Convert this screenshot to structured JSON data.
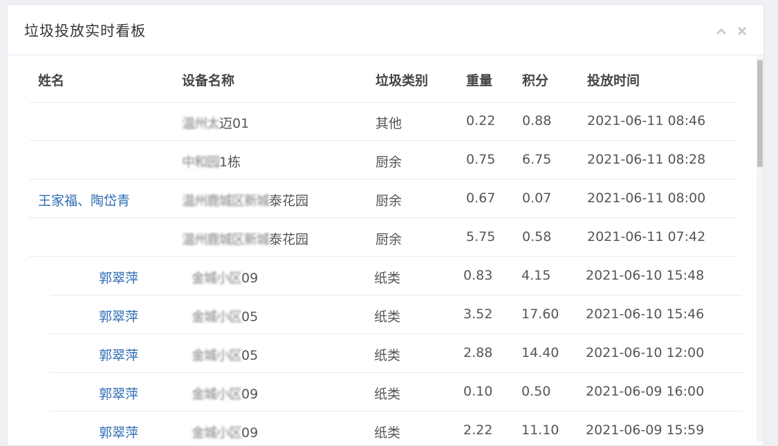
{
  "panel": {
    "title": "垃圾投放实时看板"
  },
  "icons": {
    "collapse": "chevron-up-icon",
    "close": "close-icon",
    "icon_color": "#c8ccd0"
  },
  "colors": {
    "name_link": "#2f6db3",
    "header_text": "#444444",
    "body_text": "#555555",
    "divider": "#e7eaec"
  },
  "table": {
    "columns": [
      "姓名",
      "设备名称",
      "垃圾类别",
      "重量",
      "积分",
      "投放时间"
    ],
    "rows": [
      {
        "name": "",
        "device_obscured": "温州太",
        "device_visible": "迈01",
        "category": "其他",
        "weight": "0.22",
        "points": "0.88",
        "time": "2021-06-11 08:46"
      },
      {
        "name": "",
        "device_obscured": "中和园",
        "device_visible": "1栋",
        "category": "厨余",
        "weight": "0.75",
        "points": "6.75",
        "time": "2021-06-11 08:28"
      },
      {
        "name": "王家福、陶岱青",
        "device_obscured": "温州鹿城区新城",
        "device_visible": "泰花园",
        "category": "厨余",
        "weight": "0.67",
        "points": "0.07",
        "time": "2021-06-11 08:00"
      },
      {
        "name": "",
        "device_obscured": "温州鹿城区新城",
        "device_visible": "泰花园",
        "category": "厨余",
        "weight": "5.75",
        "points": "0.58",
        "time": "2021-06-11 07:42"
      },
      {
        "name": "郭翠萍",
        "device_obscured": "金城小区",
        "device_visible": "09",
        "category": "纸类",
        "weight": "0.83",
        "points": "4.15",
        "time": "2021-06-10 15:48"
      },
      {
        "name": "郭翠萍",
        "device_obscured": "金城小区",
        "device_visible": "05",
        "category": "纸类",
        "weight": "3.52",
        "points": "17.60",
        "time": "2021-06-10 15:46"
      },
      {
        "name": "郭翠萍",
        "device_obscured": "金城小区",
        "device_visible": "05",
        "category": "纸类",
        "weight": "2.88",
        "points": "14.40",
        "time": "2021-06-10 12:00"
      },
      {
        "name": "郭翠萍",
        "device_obscured": "金城小区",
        "device_visible": "09",
        "category": "纸类",
        "weight": "0.10",
        "points": "0.50",
        "time": "2021-06-09 16:00"
      },
      {
        "name": "郭翠萍",
        "device_obscured": "金城小区",
        "device_visible": "09",
        "category": "纸类",
        "weight": "2.22",
        "points": "11.10",
        "time": "2021-06-09 15:59"
      }
    ]
  }
}
